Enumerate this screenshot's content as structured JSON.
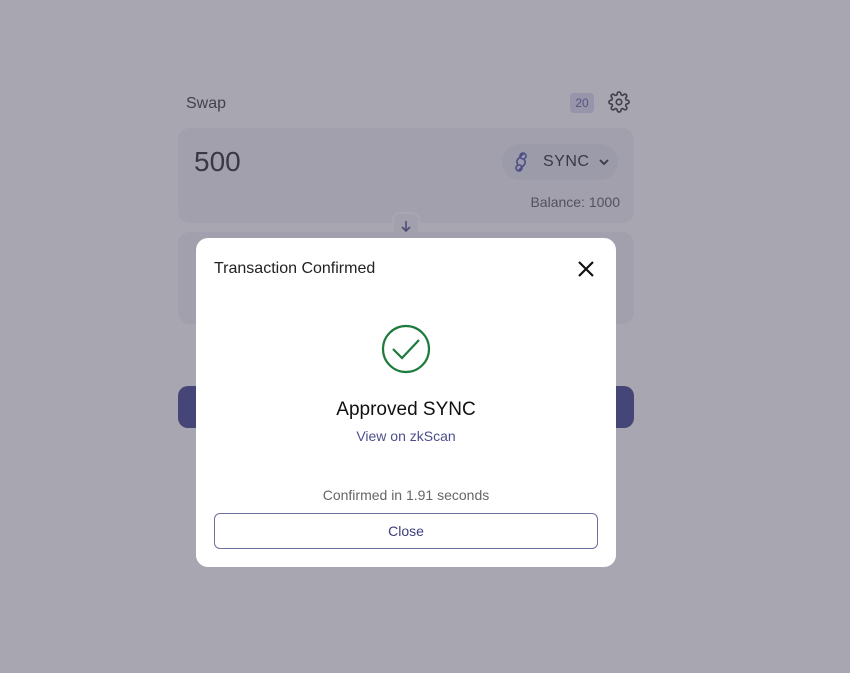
{
  "swap": {
    "title": "Swap",
    "slippage_badge": "20",
    "amount": "500",
    "token_symbol": "SYNC",
    "balance": "Balance: 1000"
  },
  "modal": {
    "title": "Transaction Confirmed",
    "heading": "Approved SYNC",
    "link": "View on zkScan",
    "confirm_text": "Confirmed in 1.91 seconds",
    "close_label": "Close"
  },
  "colors": {
    "accent": "#3a3c8c",
    "success": "#1f7a3d",
    "overlay": "rgba(80,78,100,0.5)"
  },
  "icons": [
    "gear-icon",
    "sync-token-icon",
    "chevron-down-icon",
    "arrow-down-icon",
    "close-icon",
    "check-circle-icon"
  ]
}
